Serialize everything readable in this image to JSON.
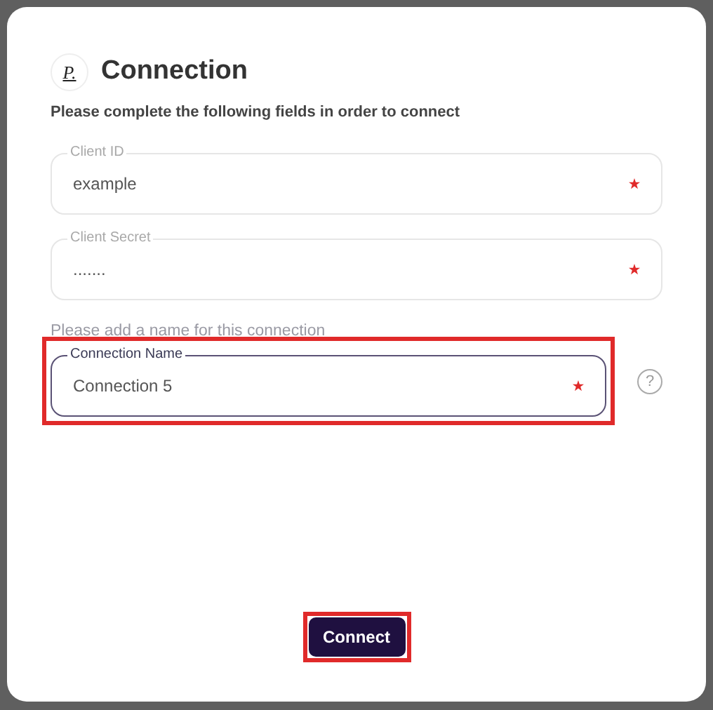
{
  "dialog": {
    "logo": "P.",
    "title": "Connection",
    "subtitle": "Please complete the following fields in order to connect"
  },
  "fields": [
    {
      "label": "Client ID",
      "value": "example",
      "required": true,
      "focused": false,
      "highlighted": false,
      "help": false
    },
    {
      "label": "Client Secret",
      "value": ".......",
      "required": true,
      "focused": false,
      "highlighted": false,
      "help": false
    },
    {
      "hint": "Please add a name for this connection",
      "label": "Connection Name",
      "value": "Connection 5",
      "required": true,
      "focused": true,
      "highlighted": true,
      "help": true
    }
  ],
  "help_icon": "?",
  "button": {
    "label": "Connect",
    "highlighted": true
  }
}
